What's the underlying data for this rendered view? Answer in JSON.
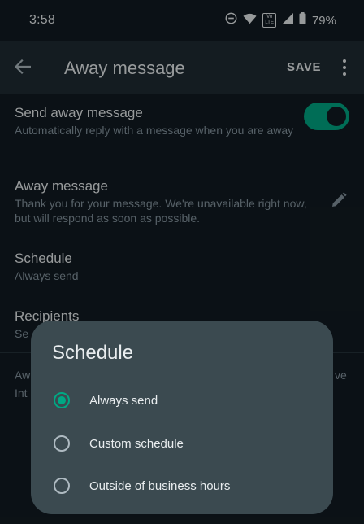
{
  "status_bar": {
    "time": "3:58",
    "volte": [
      "Vo",
      "LTE"
    ],
    "battery": "79%",
    "icons": [
      "do-not-disturb-icon",
      "wifi-icon",
      "volte-icon",
      "signal-icon",
      "battery-icon"
    ]
  },
  "app_bar": {
    "title": "Away message",
    "save_label": "SAVE",
    "back_icon": "arrow-left-icon",
    "more_icon": "more-vert-icon"
  },
  "settings": {
    "send_away": {
      "title": "Send away message",
      "subtitle": "Automatically reply with a message when you are away",
      "enabled": true
    },
    "away_message": {
      "title": "Away message",
      "subtitle": "Thank you for your message. We're unavailable right now, but will respond as soon as possible.",
      "edit_icon": "pencil-icon"
    },
    "schedule": {
      "title": "Schedule",
      "subtitle": "Always send"
    },
    "recipients": {
      "title": "Recipients",
      "subtitle": "Se"
    },
    "footer_partial": {
      "line1_left": "Aw",
      "line1_right": "ve",
      "line2_left": "Int"
    }
  },
  "dialog": {
    "title": "Schedule",
    "options": [
      {
        "label": "Always send",
        "selected": true
      },
      {
        "label": "Custom schedule",
        "selected": false
      },
      {
        "label": "Outside of business hours",
        "selected": false
      }
    ]
  },
  "colors": {
    "background": "#121b22",
    "app_bar": "#1f2c34",
    "accent": "#00a884",
    "dialog": "#3b4a50",
    "secondary_text": "#8696a0"
  }
}
